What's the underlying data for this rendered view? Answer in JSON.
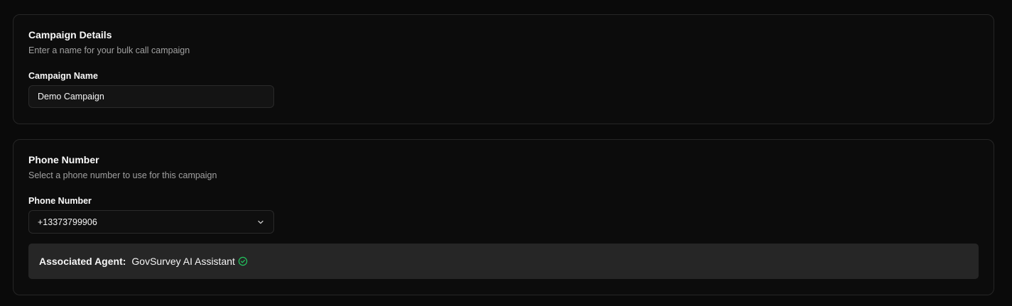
{
  "campaign_section": {
    "title": "Campaign Details",
    "description": "Enter a name for your bulk call campaign",
    "name_label": "Campaign Name",
    "name_value": "Demo Campaign"
  },
  "phone_section": {
    "title": "Phone Number",
    "description": "Select a phone number to use for this campaign",
    "phone_label": "Phone Number",
    "phone_value": "+13373799906",
    "associated_agent_label": "Associated Agent:",
    "associated_agent_name": "GovSurvey AI Assistant",
    "verified_icon": "check-circle-icon",
    "verified_color": "#22c55e"
  }
}
